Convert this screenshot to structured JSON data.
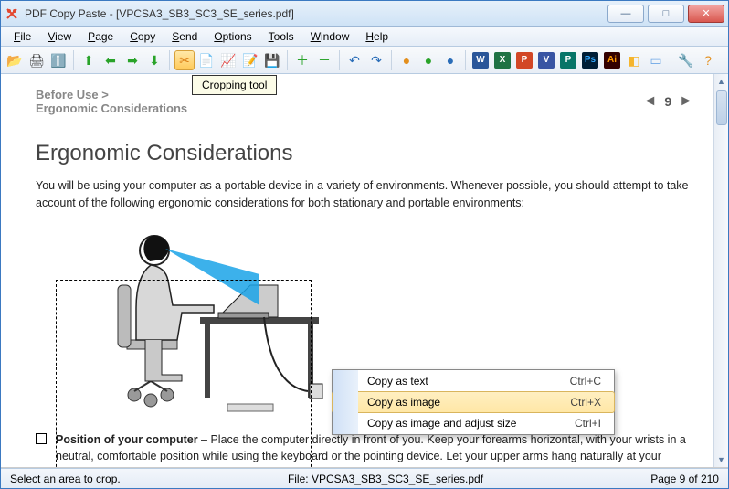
{
  "title": "PDF Copy Paste - [VPCSA3_SB3_SC3_SE_series.pdf]",
  "menus": [
    "File",
    "View",
    "Page",
    "Copy",
    "Send",
    "Options",
    "Tools",
    "Window",
    "Help"
  ],
  "tooltip": "Cropping tool",
  "doc": {
    "breadcrumb": "Before Use >",
    "section": "Ergonomic Considerations",
    "pagenum": "9",
    "heading": "Ergonomic Considerations",
    "intro": "You will be using your computer as a portable device in a variety of environments. Whenever possible, you should attempt to take account of the following ergonomic considerations for both stationary and portable environments:",
    "bullet_title": "Position of your computer",
    "bullet_text": " – Place the computer directly in front of you. Keep your forearms horizontal, with your wrists in a neutral, comfortable position while using the keyboard or the pointing device. Let your upper arms hang naturally at your sides. Take frequent breaks while using your computer. Excessive use of the computer may strain eyes, muscles, or"
  },
  "context_menu": {
    "items": [
      {
        "label": "Copy as text",
        "shortcut": "Ctrl+C",
        "sel": false
      },
      {
        "label": "Copy as image",
        "shortcut": "Ctrl+X",
        "sel": true
      },
      {
        "label": "Copy as image and adjust size",
        "shortcut": "Ctrl+I",
        "sel": false
      }
    ]
  },
  "status": {
    "hint": "Select an area to crop.",
    "file": "File: VPCSA3_SB3_SC3_SE_series.pdf",
    "page": "Page 9 of 210"
  },
  "toolbar_icons": [
    {
      "name": "open-icon",
      "glyph": "📂"
    },
    {
      "name": "print-icon",
      "glyph": "🖨"
    },
    {
      "name": "info-icon",
      "glyph": "ℹ️"
    },
    {
      "name": "sep"
    },
    {
      "name": "up-green-icon",
      "glyph": "⬆",
      "color": "#29a329"
    },
    {
      "name": "left-green-icon",
      "glyph": "⬅",
      "color": "#29a329"
    },
    {
      "name": "right-green-icon",
      "glyph": "➡",
      "color": "#29a329"
    },
    {
      "name": "down-green-icon",
      "glyph": "⬇",
      "color": "#29a329"
    },
    {
      "name": "sep"
    },
    {
      "name": "crop-tool-icon",
      "glyph": "✂",
      "active": true,
      "color": "#d97b11"
    },
    {
      "name": "copy-icon",
      "glyph": "📄"
    },
    {
      "name": "chart-icon",
      "glyph": "📈"
    },
    {
      "name": "text-icon",
      "glyph": "📝"
    },
    {
      "name": "save-icon",
      "glyph": "💾"
    },
    {
      "name": "sep"
    },
    {
      "name": "add-green-icon",
      "glyph": "＋",
      "color": "#29a329"
    },
    {
      "name": "remove-green-icon",
      "glyph": "－",
      "color": "#29a329"
    },
    {
      "name": "sep"
    },
    {
      "name": "undo-icon",
      "glyph": "↶",
      "color": "#2a6db8"
    },
    {
      "name": "redo-icon",
      "glyph": "↷",
      "color": "#2a6db8"
    },
    {
      "name": "sep"
    },
    {
      "name": "dot-orange-icon",
      "glyph": "●",
      "color": "#e38f1d"
    },
    {
      "name": "dot-green-icon",
      "glyph": "●",
      "color": "#29a329"
    },
    {
      "name": "dot-blue-icon",
      "glyph": "●",
      "color": "#2a6db8"
    },
    {
      "name": "sep"
    },
    {
      "name": "word-icon",
      "glyph": "W",
      "color": "#2a5699",
      "box": true
    },
    {
      "name": "excel-icon",
      "glyph": "X",
      "color": "#1f7244",
      "box": true
    },
    {
      "name": "powerpoint-icon",
      "glyph": "P",
      "color": "#d24726",
      "box": true
    },
    {
      "name": "visio-icon",
      "glyph": "V",
      "color": "#3955a3",
      "box": true
    },
    {
      "name": "publisher-icon",
      "glyph": "P",
      "color": "#077568",
      "box": true
    },
    {
      "name": "photoshop-icon",
      "glyph": "Ps",
      "color": "#001e36",
      "box": true,
      "fg": "#31a8ff"
    },
    {
      "name": "illustrator-icon",
      "glyph": "Ai",
      "color": "#330000",
      "box": true,
      "fg": "#ff9a00"
    },
    {
      "name": "misc-icon",
      "glyph": "◧",
      "color": "#f5b52e"
    },
    {
      "name": "doc-icon",
      "glyph": "▭",
      "color": "#6fa8e6"
    },
    {
      "name": "sep"
    },
    {
      "name": "wrench-icon",
      "glyph": "🔧"
    },
    {
      "name": "help-icon",
      "glyph": "?",
      "color": "#e38f1d"
    }
  ]
}
